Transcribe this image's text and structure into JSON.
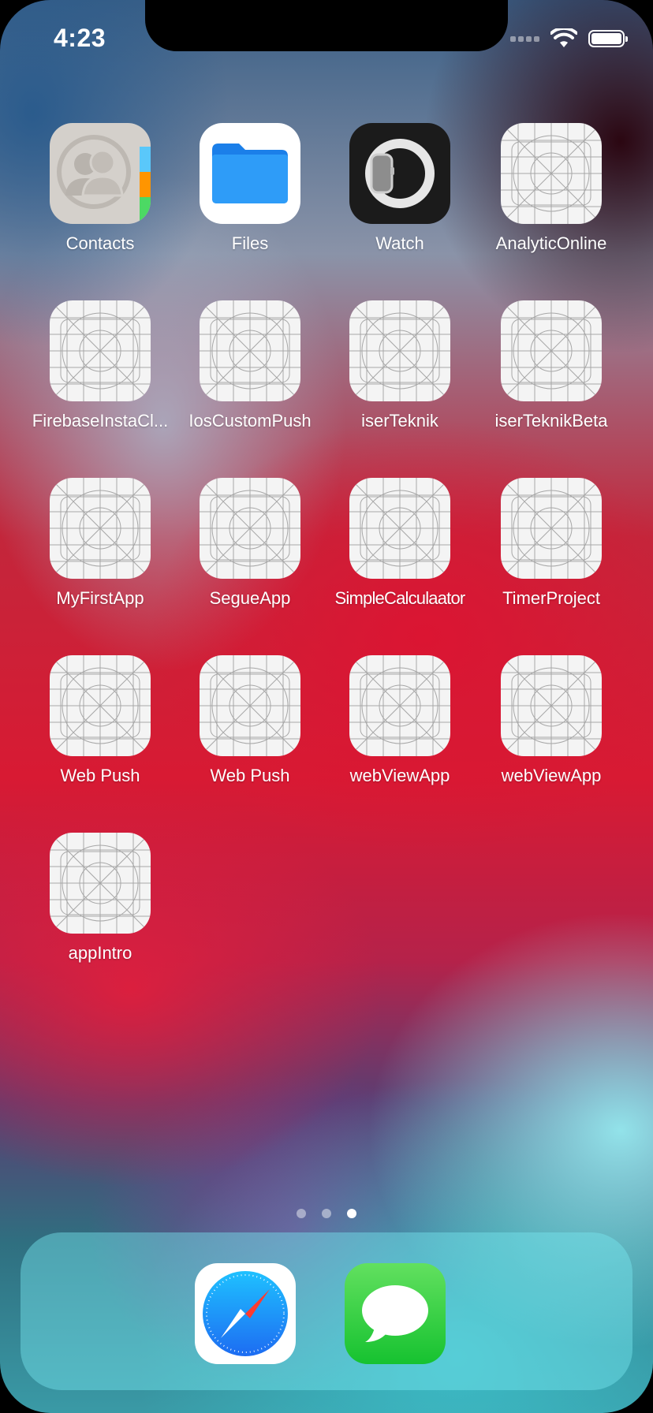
{
  "status_bar": {
    "time": "4:23",
    "icons": [
      "signal-icon",
      "wifi-icon",
      "battery-icon"
    ]
  },
  "apps": [
    {
      "name": "Contacts",
      "icon": "contacts-icon"
    },
    {
      "name": "Files",
      "icon": "files-icon"
    },
    {
      "name": "Watch",
      "icon": "watch-icon"
    },
    {
      "name": "AnalyticOnline",
      "icon": "placeholder-app-icon"
    },
    {
      "name": "FirebaseInstaCl...",
      "icon": "placeholder-app-icon"
    },
    {
      "name": "IosCustomPush",
      "icon": "placeholder-app-icon"
    },
    {
      "name": "iserTeknik",
      "icon": "placeholder-app-icon"
    },
    {
      "name": "iserTeknikBeta",
      "icon": "placeholder-app-icon"
    },
    {
      "name": "MyFirstApp",
      "icon": "placeholder-app-icon"
    },
    {
      "name": "SegueApp",
      "icon": "placeholder-app-icon"
    },
    {
      "name": "SimpleCalculaator",
      "icon": "placeholder-app-icon"
    },
    {
      "name": "TimerProject",
      "icon": "placeholder-app-icon"
    },
    {
      "name": "Web Push",
      "icon": "placeholder-app-icon"
    },
    {
      "name": "Web Push",
      "icon": "placeholder-app-icon"
    },
    {
      "name": "webViewApp",
      "icon": "placeholder-app-icon"
    },
    {
      "name": "webViewApp",
      "icon": "placeholder-app-icon"
    },
    {
      "name": "appIntro",
      "icon": "placeholder-app-icon"
    }
  ],
  "page_indicator": {
    "total": 3,
    "current": 3
  },
  "dock": [
    {
      "icon": "safari-icon"
    },
    {
      "icon": "messages-icon"
    }
  ],
  "colors": {
    "contacts_tabs": [
      "#5ac8fa",
      "#ff9500",
      "#4cd964"
    ],
    "files_folder": "#1e8cf5",
    "messages_green": "#28cd41"
  }
}
